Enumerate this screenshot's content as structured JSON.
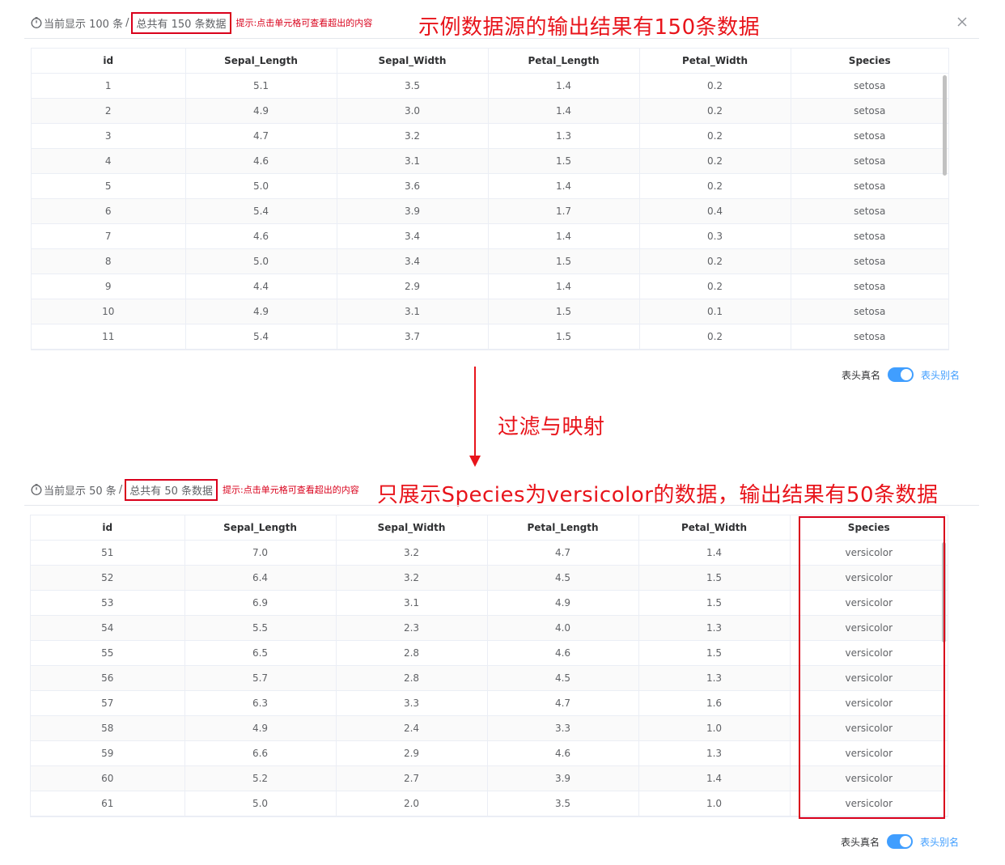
{
  "colors": {
    "accent": "#409eff",
    "annotation": "#e8141b",
    "highlight_box": "#d9001b"
  },
  "icons": {
    "timer": "clock-icon",
    "close": "close-icon"
  },
  "columns": [
    "id",
    "Sepal_Length",
    "Sepal_Width",
    "Petal_Length",
    "Petal_Width",
    "Species"
  ],
  "top": {
    "showing": "当前显示 100 条",
    "separator": "/",
    "total": "总共有 150 条数据",
    "hint": "提示:点击单元格可查看超出的内容",
    "annotation": "示例数据源的输出结果有150条数据",
    "toggle_left": "表头真名",
    "toggle_right": "表头别名",
    "rows": [
      [
        "1",
        "5.1",
        "3.5",
        "1.4",
        "0.2",
        "setosa"
      ],
      [
        "2",
        "4.9",
        "3.0",
        "1.4",
        "0.2",
        "setosa"
      ],
      [
        "3",
        "4.7",
        "3.2",
        "1.3",
        "0.2",
        "setosa"
      ],
      [
        "4",
        "4.6",
        "3.1",
        "1.5",
        "0.2",
        "setosa"
      ],
      [
        "5",
        "5.0",
        "3.6",
        "1.4",
        "0.2",
        "setosa"
      ],
      [
        "6",
        "5.4",
        "3.9",
        "1.7",
        "0.4",
        "setosa"
      ],
      [
        "7",
        "4.6",
        "3.4",
        "1.4",
        "0.3",
        "setosa"
      ],
      [
        "8",
        "5.0",
        "3.4",
        "1.5",
        "0.2",
        "setosa"
      ],
      [
        "9",
        "4.4",
        "2.9",
        "1.4",
        "0.2",
        "setosa"
      ],
      [
        "10",
        "4.9",
        "3.1",
        "1.5",
        "0.1",
        "setosa"
      ],
      [
        "11",
        "5.4",
        "3.7",
        "1.5",
        "0.2",
        "setosa"
      ]
    ]
  },
  "transform_label": "过滤与映射",
  "bottom": {
    "showing": "当前显示 50 条",
    "separator": "/",
    "total": "总共有 50 条数据",
    "hint": "提示:点击单元格可查看超出的内容",
    "annotation": "只展示Species为versicolor的数据，输出结果有50条数据",
    "toggle_left": "表头真名",
    "toggle_right": "表头别名",
    "rows": [
      [
        "51",
        "7.0",
        "3.2",
        "4.7",
        "1.4",
        "versicolor"
      ],
      [
        "52",
        "6.4",
        "3.2",
        "4.5",
        "1.5",
        "versicolor"
      ],
      [
        "53",
        "6.9",
        "3.1",
        "4.9",
        "1.5",
        "versicolor"
      ],
      [
        "54",
        "5.5",
        "2.3",
        "4.0",
        "1.3",
        "versicolor"
      ],
      [
        "55",
        "6.5",
        "2.8",
        "4.6",
        "1.5",
        "versicolor"
      ],
      [
        "56",
        "5.7",
        "2.8",
        "4.5",
        "1.3",
        "versicolor"
      ],
      [
        "57",
        "6.3",
        "3.3",
        "4.7",
        "1.6",
        "versicolor"
      ],
      [
        "58",
        "4.9",
        "2.4",
        "3.3",
        "1.0",
        "versicolor"
      ],
      [
        "59",
        "6.6",
        "2.9",
        "4.6",
        "1.3",
        "versicolor"
      ],
      [
        "60",
        "5.2",
        "2.7",
        "3.9",
        "1.4",
        "versicolor"
      ],
      [
        "61",
        "5.0",
        "2.0",
        "3.5",
        "1.0",
        "versicolor"
      ]
    ]
  }
}
